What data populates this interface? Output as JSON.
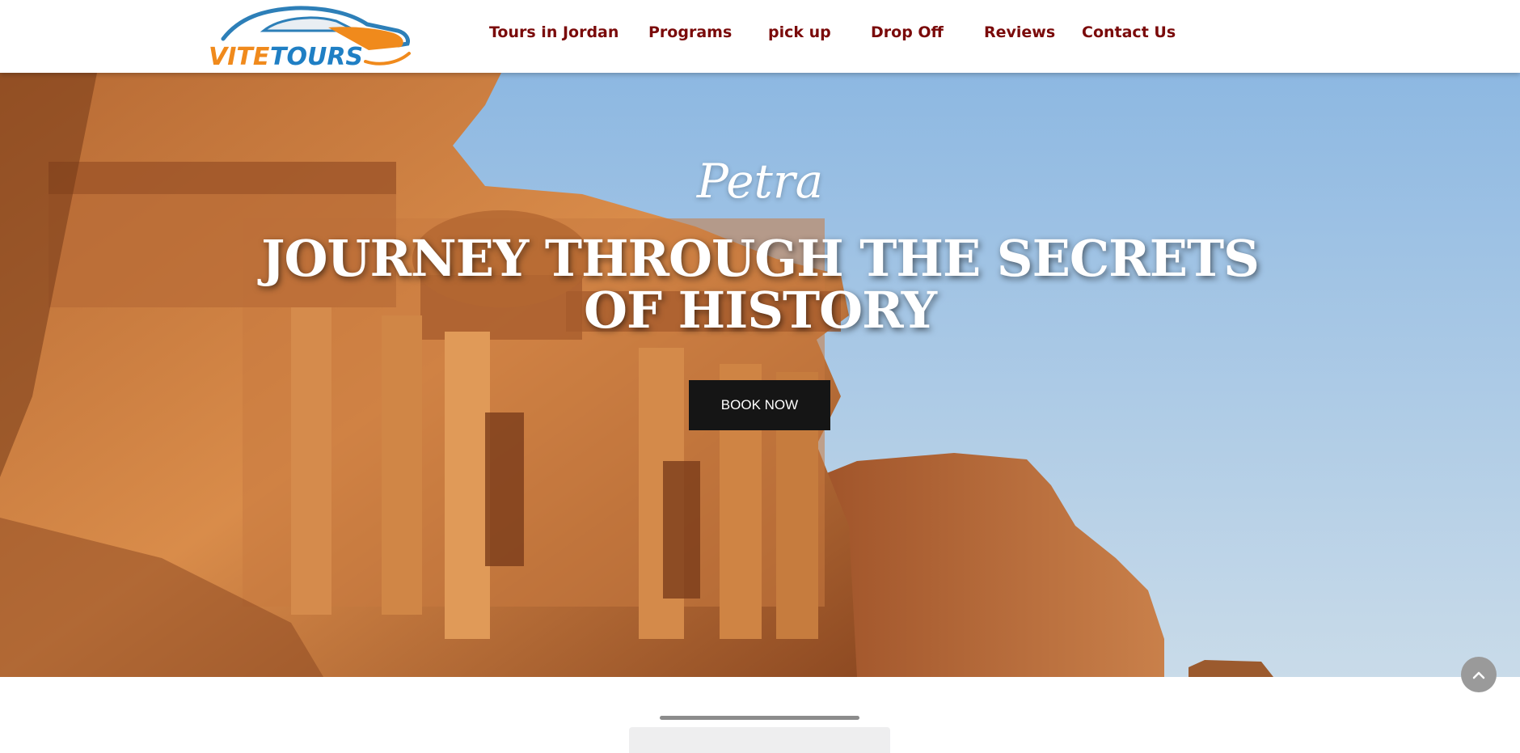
{
  "brand": {
    "logo_text_part1": "VITE",
    "logo_text_part2": "TOURS",
    "colors": {
      "orange": "#f08a1c",
      "blue": "#1f7fc4",
      "nav_text": "#7a0a0a"
    }
  },
  "nav": {
    "items": [
      {
        "label": "Tours in Jordan"
      },
      {
        "label": "Programs"
      },
      {
        "label": "pick up"
      },
      {
        "label": "Drop Off"
      },
      {
        "label": "Reviews"
      },
      {
        "label": "Contact Us"
      }
    ]
  },
  "hero": {
    "subtitle": "Petra",
    "title": "JOURNEY THROUGH THE SECRETS OF HISTORY",
    "cta_label": "BOOK NOW",
    "background": "petra-monastery-photo"
  },
  "scroll_top": {
    "icon": "chevron-up-icon"
  }
}
